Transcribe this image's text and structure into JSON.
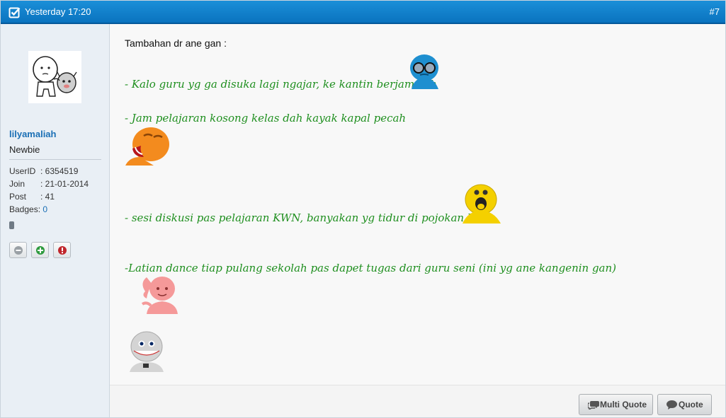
{
  "header": {
    "date": "Yesterday 17:20",
    "post_number": "#7"
  },
  "user": {
    "username": "lilyamaliah",
    "rank": "Newbie",
    "userid_label": "UserID",
    "userid_value": ": 6354519",
    "join_label": "Join",
    "join_value": ": 21-01-2014",
    "post_label": "Post",
    "post_value": ": 41",
    "badges_label": "Badges:",
    "badges_value": "0"
  },
  "post": {
    "intro": "Tambahan dr ane gan :",
    "lines": [
      "- Kalo guru yg ga disuka lagi ngajar, ke kantin berjama'ah",
      "- Jam pelajaran kosong kelas dah kayak kapal pecah",
      "- sesi diskusi pas pelajaran KWN, banyakan yg tidur di pojokan kelas",
      "-Latian dance tiap pulang sekolah pas dapet tugas dari guru seni (ini yg ane kangenin gan)"
    ]
  },
  "buttons": {
    "multi_quote": "Multi Quote",
    "quote": "Quote"
  },
  "colors": {
    "header": "#0a73bf",
    "username": "#1a6fb5",
    "post_text": "#1f8f1f"
  },
  "icons": [
    "checkbox-icon",
    "profile-icon",
    "add-friend-icon",
    "report-icon",
    "online-status-icon",
    "speech-bubbles-icon",
    "speech-bubble-icon"
  ]
}
